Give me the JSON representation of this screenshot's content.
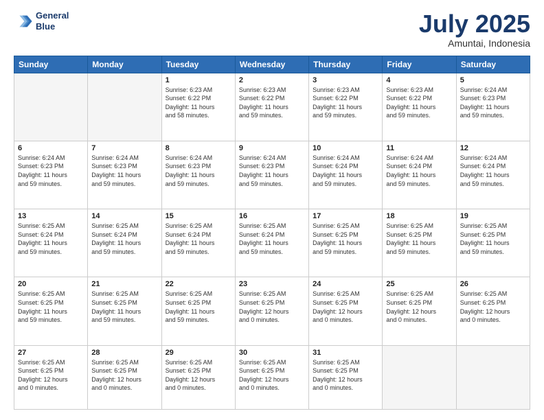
{
  "header": {
    "logo_line1": "General",
    "logo_line2": "Blue",
    "title": "July 2025",
    "subtitle": "Amuntai, Indonesia"
  },
  "calendar": {
    "days_of_week": [
      "Sunday",
      "Monday",
      "Tuesday",
      "Wednesday",
      "Thursday",
      "Friday",
      "Saturday"
    ],
    "weeks": [
      [
        {
          "day": "",
          "info": ""
        },
        {
          "day": "",
          "info": ""
        },
        {
          "day": "1",
          "info": "Sunrise: 6:23 AM\nSunset: 6:22 PM\nDaylight: 11 hours\nand 58 minutes."
        },
        {
          "day": "2",
          "info": "Sunrise: 6:23 AM\nSunset: 6:22 PM\nDaylight: 11 hours\nand 59 minutes."
        },
        {
          "day": "3",
          "info": "Sunrise: 6:23 AM\nSunset: 6:22 PM\nDaylight: 11 hours\nand 59 minutes."
        },
        {
          "day": "4",
          "info": "Sunrise: 6:23 AM\nSunset: 6:22 PM\nDaylight: 11 hours\nand 59 minutes."
        },
        {
          "day": "5",
          "info": "Sunrise: 6:24 AM\nSunset: 6:23 PM\nDaylight: 11 hours\nand 59 minutes."
        }
      ],
      [
        {
          "day": "6",
          "info": "Sunrise: 6:24 AM\nSunset: 6:23 PM\nDaylight: 11 hours\nand 59 minutes."
        },
        {
          "day": "7",
          "info": "Sunrise: 6:24 AM\nSunset: 6:23 PM\nDaylight: 11 hours\nand 59 minutes."
        },
        {
          "day": "8",
          "info": "Sunrise: 6:24 AM\nSunset: 6:23 PM\nDaylight: 11 hours\nand 59 minutes."
        },
        {
          "day": "9",
          "info": "Sunrise: 6:24 AM\nSunset: 6:23 PM\nDaylight: 11 hours\nand 59 minutes."
        },
        {
          "day": "10",
          "info": "Sunrise: 6:24 AM\nSunset: 6:24 PM\nDaylight: 11 hours\nand 59 minutes."
        },
        {
          "day": "11",
          "info": "Sunrise: 6:24 AM\nSunset: 6:24 PM\nDaylight: 11 hours\nand 59 minutes."
        },
        {
          "day": "12",
          "info": "Sunrise: 6:24 AM\nSunset: 6:24 PM\nDaylight: 11 hours\nand 59 minutes."
        }
      ],
      [
        {
          "day": "13",
          "info": "Sunrise: 6:25 AM\nSunset: 6:24 PM\nDaylight: 11 hours\nand 59 minutes."
        },
        {
          "day": "14",
          "info": "Sunrise: 6:25 AM\nSunset: 6:24 PM\nDaylight: 11 hours\nand 59 minutes."
        },
        {
          "day": "15",
          "info": "Sunrise: 6:25 AM\nSunset: 6:24 PM\nDaylight: 11 hours\nand 59 minutes."
        },
        {
          "day": "16",
          "info": "Sunrise: 6:25 AM\nSunset: 6:24 PM\nDaylight: 11 hours\nand 59 minutes."
        },
        {
          "day": "17",
          "info": "Sunrise: 6:25 AM\nSunset: 6:25 PM\nDaylight: 11 hours\nand 59 minutes."
        },
        {
          "day": "18",
          "info": "Sunrise: 6:25 AM\nSunset: 6:25 PM\nDaylight: 11 hours\nand 59 minutes."
        },
        {
          "day": "19",
          "info": "Sunrise: 6:25 AM\nSunset: 6:25 PM\nDaylight: 11 hours\nand 59 minutes."
        }
      ],
      [
        {
          "day": "20",
          "info": "Sunrise: 6:25 AM\nSunset: 6:25 PM\nDaylight: 11 hours\nand 59 minutes."
        },
        {
          "day": "21",
          "info": "Sunrise: 6:25 AM\nSunset: 6:25 PM\nDaylight: 11 hours\nand 59 minutes."
        },
        {
          "day": "22",
          "info": "Sunrise: 6:25 AM\nSunset: 6:25 PM\nDaylight: 11 hours\nand 59 minutes."
        },
        {
          "day": "23",
          "info": "Sunrise: 6:25 AM\nSunset: 6:25 PM\nDaylight: 12 hours\nand 0 minutes."
        },
        {
          "day": "24",
          "info": "Sunrise: 6:25 AM\nSunset: 6:25 PM\nDaylight: 12 hours\nand 0 minutes."
        },
        {
          "day": "25",
          "info": "Sunrise: 6:25 AM\nSunset: 6:25 PM\nDaylight: 12 hours\nand 0 minutes."
        },
        {
          "day": "26",
          "info": "Sunrise: 6:25 AM\nSunset: 6:25 PM\nDaylight: 12 hours\nand 0 minutes."
        }
      ],
      [
        {
          "day": "27",
          "info": "Sunrise: 6:25 AM\nSunset: 6:25 PM\nDaylight: 12 hours\nand 0 minutes."
        },
        {
          "day": "28",
          "info": "Sunrise: 6:25 AM\nSunset: 6:25 PM\nDaylight: 12 hours\nand 0 minutes."
        },
        {
          "day": "29",
          "info": "Sunrise: 6:25 AM\nSunset: 6:25 PM\nDaylight: 12 hours\nand 0 minutes."
        },
        {
          "day": "30",
          "info": "Sunrise: 6:25 AM\nSunset: 6:25 PM\nDaylight: 12 hours\nand 0 minutes."
        },
        {
          "day": "31",
          "info": "Sunrise: 6:25 AM\nSunset: 6:25 PM\nDaylight: 12 hours\nand 0 minutes."
        },
        {
          "day": "",
          "info": ""
        },
        {
          "day": "",
          "info": ""
        }
      ]
    ]
  }
}
